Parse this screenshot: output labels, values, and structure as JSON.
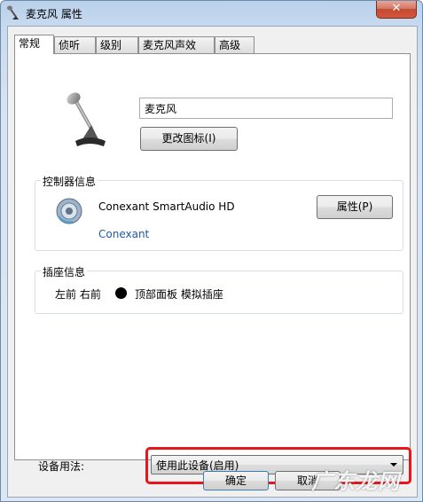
{
  "window": {
    "title": "麦克风 属性",
    "close_glyph": "✕"
  },
  "tabs": [
    {
      "label": "常规",
      "active": true
    },
    {
      "label": "侦听",
      "active": false
    },
    {
      "label": "级别",
      "active": false
    },
    {
      "label": "麦克风声效",
      "active": false
    },
    {
      "label": "高级",
      "active": false
    }
  ],
  "general": {
    "device_name": "麦克风",
    "change_icon_button": "更改图标(I)"
  },
  "controller": {
    "group_label": "控制器信息",
    "device": "Conexant SmartAudio HD",
    "vendor_link": "Conexant",
    "properties_button": "属性(P)"
  },
  "jack": {
    "group_label": "插座信息",
    "positions": "左前 右前",
    "description": "顶部面板 模拟插座",
    "dot_color": "#000000"
  },
  "device_usage": {
    "label": "设备用法:",
    "selected": "使用此设备(启用)"
  },
  "footer": {
    "ok_button": "确定",
    "cancel_button": "取消"
  },
  "watermark": {
    "text": "广东龙网"
  },
  "colors": {
    "highlight": "#e8161b",
    "link": "#1e5aa8"
  }
}
